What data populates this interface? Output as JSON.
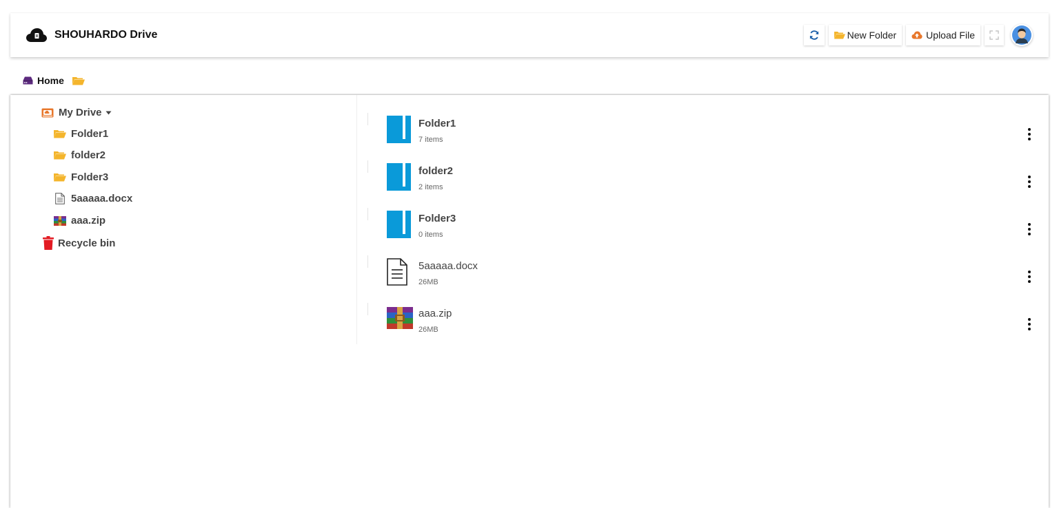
{
  "header": {
    "title": "SHOUHARDO Drive",
    "logo_icon": "cloud-file-icon",
    "buttons": {
      "refresh_icon": "refresh-icon",
      "new_folder_label": "New Folder",
      "upload_label": "Upload File",
      "fullscreen_icon": "fullscreen-icon"
    }
  },
  "breadcrumb": {
    "home_label": "Home"
  },
  "sidebar": {
    "root_label": "My Drive",
    "items": [
      {
        "label": "Folder1",
        "icon": "folder-open-icon"
      },
      {
        "label": "folder2",
        "icon": "folder-open-icon"
      },
      {
        "label": "Folder3",
        "icon": "folder-open-icon"
      },
      {
        "label": "5aaaaa.docx",
        "icon": "document-icon"
      },
      {
        "label": "aaa.zip",
        "icon": "archive-icon"
      }
    ],
    "recycle_label": "Recycle bin"
  },
  "files": [
    {
      "name": "Folder1",
      "meta": "7 items",
      "type": "folder"
    },
    {
      "name": "folder2",
      "meta": "2 items",
      "type": "folder"
    },
    {
      "name": "Folder3",
      "meta": "0 items",
      "type": "folder"
    },
    {
      "name": "5aaaaa.docx",
      "meta": "26MB",
      "type": "document"
    },
    {
      "name": "aaa.zip",
      "meta": "26MB",
      "type": "archive"
    }
  ],
  "colors": {
    "folder_blue": "#0a9ad9",
    "folder_yellow": "#f4b52c",
    "drive_orange": "#e8772b",
    "recycle_red": "#e31b23",
    "home_purple": "#5c2a7e"
  }
}
